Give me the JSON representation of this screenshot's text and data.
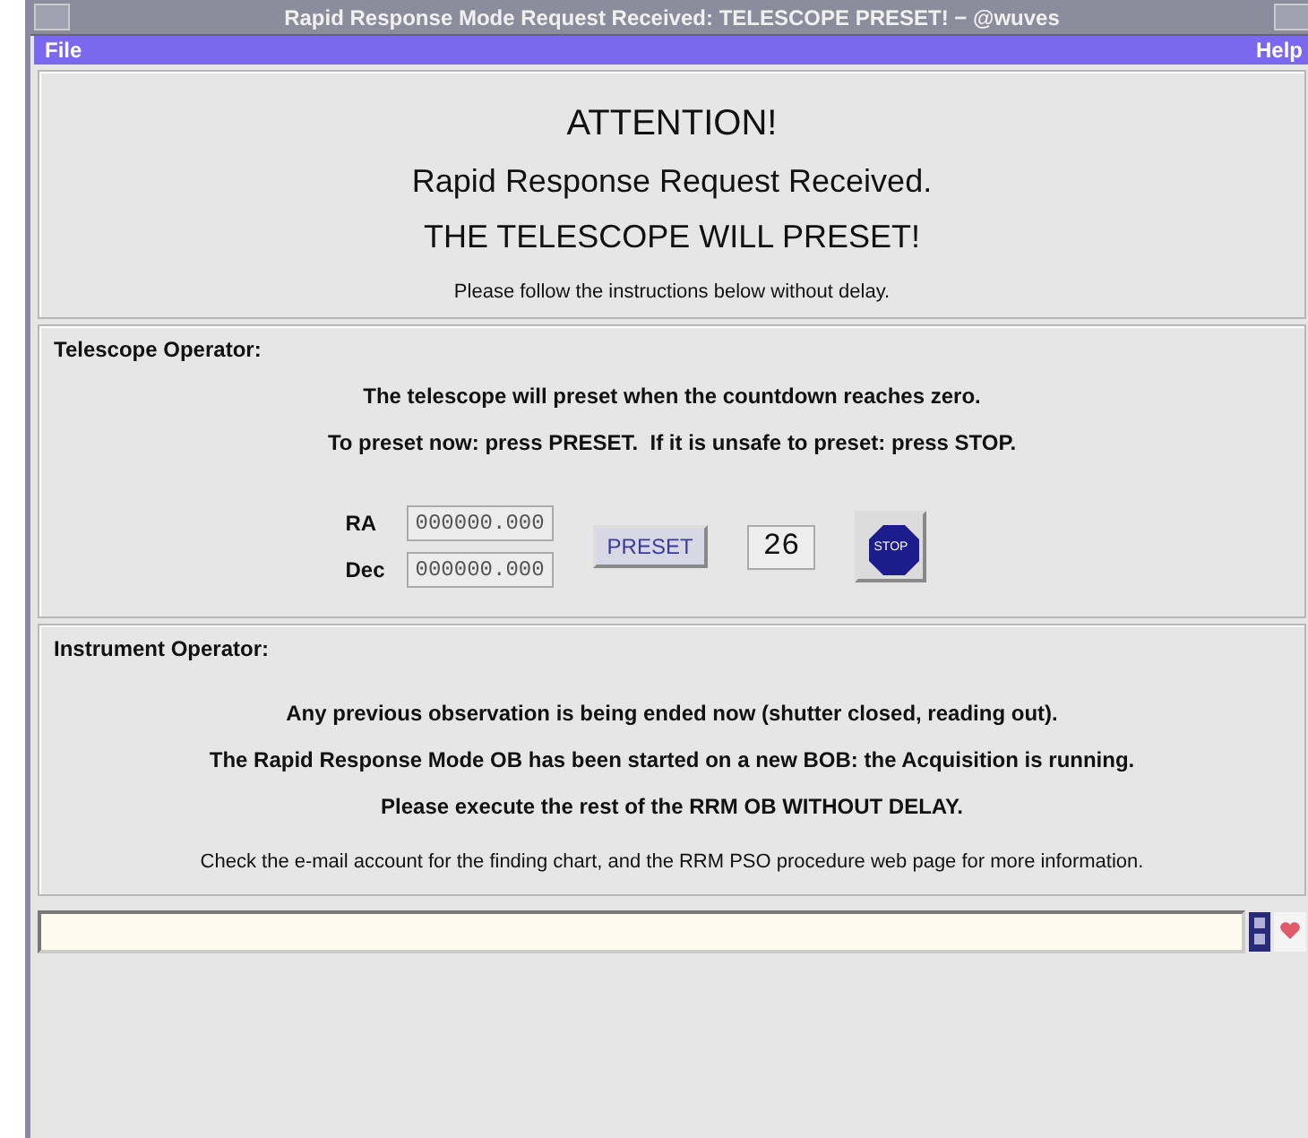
{
  "window": {
    "title": "Rapid Response Mode Request Received: TELESCOPE PRESET! − @wuves"
  },
  "menu": [
    "File",
    "Help"
  ],
  "attention": {
    "heading": "ATTENTION!",
    "lines": [
      "Rapid Response Request Received.",
      "THE TELESCOPE WILL PRESET!"
    ],
    "note": "Please follow the instructions below without delay."
  },
  "telescope": {
    "title": "Telescope Operator:",
    "lines": [
      "The telescope will preset when the countdown reaches zero.",
      "To preset now: press PRESET.  If it is unsafe to preset: press STOP."
    ],
    "fields": [
      {
        "label": "RA",
        "value": "000000.000"
      },
      {
        "label": "Dec",
        "value": "000000.000"
      }
    ],
    "preset_button": "PRESET",
    "countdown": "26",
    "stop_button": "STOP"
  },
  "instrument": {
    "title": "Instrument Operator:",
    "lines": [
      "Any previous observation is being ended now (shutter closed, reading out).",
      "The Rapid Response Mode OB has been started on a new BOB: the Acquisition is running.",
      "Please execute the rest of the RRM OB WITHOUT DELAY."
    ],
    "note": "Check the e-mail account for the finding chart, and the RRM PSO procedure web page for more information."
  }
}
